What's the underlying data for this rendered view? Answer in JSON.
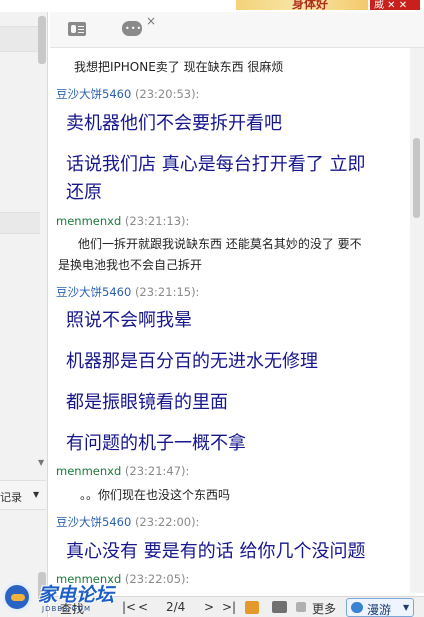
{
  "banner": {
    "text": "身体好",
    "close_text": "威 ✕ ✕"
  },
  "sidebar": {
    "history_label": "记录"
  },
  "messages": [
    {
      "kind": "text",
      "size": "small",
      "text": "我想把IPHONE卖了 现在缺东西 很麻烦"
    },
    {
      "kind": "sender",
      "name": "豆沙大饼5460",
      "time": "(23:20:53):",
      "color": "blue"
    },
    {
      "kind": "text",
      "size": "big",
      "text": "卖机器他们不会要拆开看吧"
    },
    {
      "kind": "text",
      "size": "big",
      "text": "话说我们店  真心是每台打开看了 立即"
    },
    {
      "kind": "text",
      "size": "big",
      "text": "还原"
    },
    {
      "kind": "sender",
      "name": "menmenxd",
      "time": "(23:21:13):",
      "color": "green"
    },
    {
      "kind": "text",
      "size": "small",
      "text": "他们一拆开就跟我说缺东西  还能莫名其妙的没了 要不"
    },
    {
      "kind": "text",
      "size": "small",
      "text": "是换电池我也不会自己拆开"
    },
    {
      "kind": "sender",
      "name": "豆沙大饼5460",
      "time": "(23:21:15):",
      "color": "blue"
    },
    {
      "kind": "text",
      "size": "big",
      "text": "照说不会啊我晕"
    },
    {
      "kind": "text",
      "size": "big",
      "text": "机器那是百分百的无进水无修理"
    },
    {
      "kind": "text",
      "size": "big",
      "text": "都是振眼镜看的里面"
    },
    {
      "kind": "text",
      "size": "big",
      "text": "有问题的机子一概不拿"
    },
    {
      "kind": "sender",
      "name": "menmenxd",
      "time": "(23:21:47):",
      "color": "green"
    },
    {
      "kind": "text",
      "size": "small",
      "text": "。。你们现在也没这个东西吗"
    },
    {
      "kind": "sender",
      "name": "豆沙大饼5460",
      "time": "(23:22:00):",
      "color": "blue"
    },
    {
      "kind": "text",
      "size": "big",
      "text": "真心没有  要是有的话   给你几个没问题"
    },
    {
      "kind": "sender",
      "name": "menmenxd",
      "time": "(23:22:05):",
      "color": "green"
    }
  ],
  "toolbar": {
    "find_label": "查找",
    "first": "|<",
    "prev": "<",
    "page": "2/4",
    "next": ">",
    "last": ">|",
    "more_label": "更多",
    "roam_label": "漫游"
  },
  "watermark": {
    "brand": "家电论坛",
    "url": "JDBBS.COM"
  },
  "icons": [
    "contact-card-icon",
    "chat-bubble-icon",
    "close-icon",
    "calendar-icon",
    "image-icon",
    "more-icon",
    "roam-icon",
    "chevron-down-icon"
  ]
}
